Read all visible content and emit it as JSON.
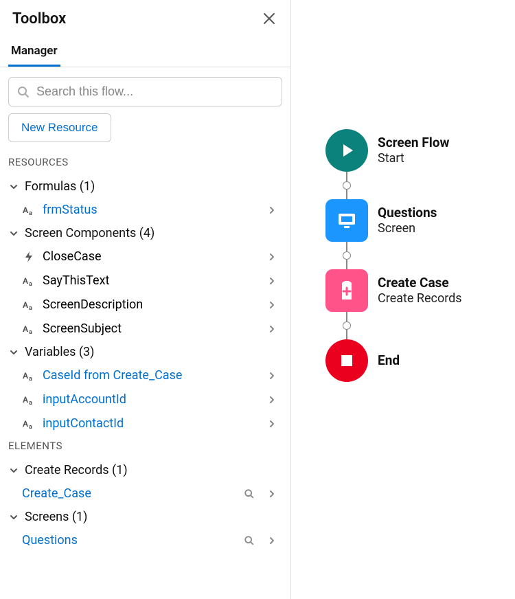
{
  "toolbox": {
    "title": "Toolbox",
    "tab": "Manager",
    "search_placeholder": "Search this flow...",
    "new_resource_label": "New Resource",
    "sections": {
      "resources_heading": "RESOURCES",
      "elements_heading": "ELEMENTS"
    },
    "resource_groups": [
      {
        "label": "Formulas (1)",
        "items": [
          {
            "label": "frmStatus",
            "icon": "text",
            "link": true
          }
        ]
      },
      {
        "label": "Screen Components (4)",
        "items": [
          {
            "label": "CloseCase",
            "icon": "bolt",
            "link": false
          },
          {
            "label": "SayThisText",
            "icon": "text",
            "link": false
          },
          {
            "label": "ScreenDescription",
            "icon": "text",
            "link": false
          },
          {
            "label": "ScreenSubject",
            "icon": "text",
            "link": false
          }
        ]
      },
      {
        "label": "Variables (3)",
        "items": [
          {
            "label": "CaseId from Create_Case",
            "icon": "text",
            "link": true
          },
          {
            "label": "inputAccountId",
            "icon": "text",
            "link": true
          },
          {
            "label": "inputContactId",
            "icon": "text",
            "link": true
          }
        ]
      }
    ],
    "element_groups": [
      {
        "label": "Create Records (1)",
        "items": [
          {
            "label": "Create_Case",
            "link": true,
            "searchable": true
          }
        ]
      },
      {
        "label": "Screens (1)",
        "items": [
          {
            "label": "Questions",
            "link": true,
            "searchable": true
          }
        ]
      }
    ]
  },
  "canvas": {
    "nodes": [
      {
        "title": "Screen Flow",
        "subtitle": "Start",
        "kind": "start"
      },
      {
        "title": "Questions",
        "subtitle": "Screen",
        "kind": "screen"
      },
      {
        "title": "Create Case",
        "subtitle": "Create Records",
        "kind": "create"
      },
      {
        "title": "End",
        "subtitle": "",
        "kind": "end"
      }
    ]
  }
}
